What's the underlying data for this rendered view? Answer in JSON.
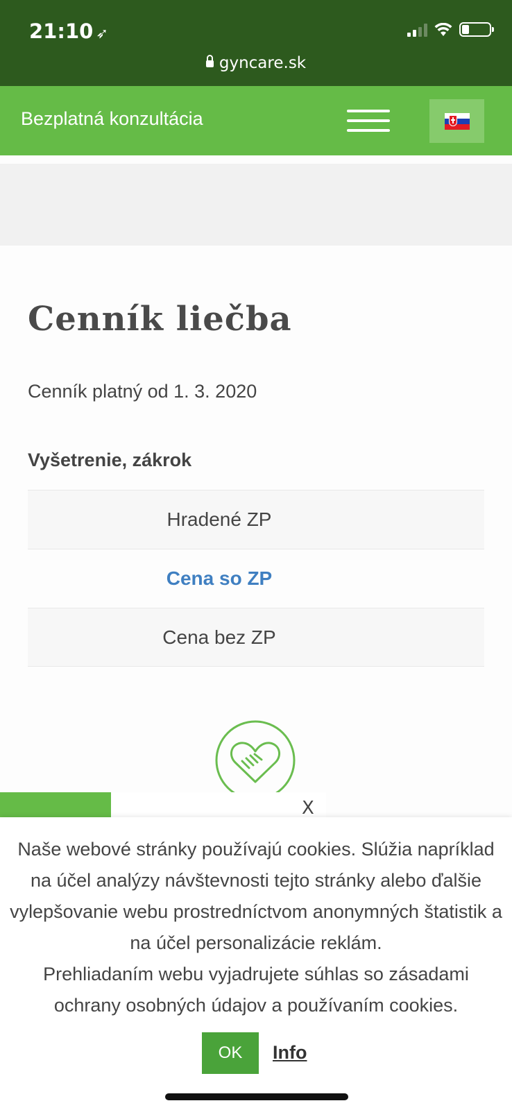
{
  "status_bar": {
    "time": "21:10",
    "location_icon": "location-arrow-icon",
    "url": "gyncare.sk"
  },
  "nav": {
    "consult_label": "Bezplatná konzultácia",
    "menu_icon": "hamburger-icon",
    "language_flag": "slovak-flag-icon"
  },
  "content": {
    "title": "Cenník liečba",
    "validity": "Cenník platný od 1. 3. 2020",
    "exam_label": "Vyšetrenie, zákrok",
    "rows": [
      {
        "label": "Hradené ZP"
      },
      {
        "label": "Cena so ZP"
      },
      {
        "label": "Cena bez ZP"
      }
    ],
    "accent_color": "#3f7fc1"
  },
  "popup": {
    "close_label": "X"
  },
  "cookie": {
    "text": "Naše webové stránky používajú cookies. Slúžia napríklad na účel analýzy návštevnosti tejto stránky alebo ďalšie vylepšovanie webu prostredníctvom anonymných štatistik a na účel personalizácie reklám.",
    "text2": "Prehliadaním webu vyjadrujete súhlas so zásadami ochrany osobných údajov a používaním cookies.",
    "ok_label": "OK",
    "info_label": "Info"
  },
  "colors": {
    "status_bg": "#2d5a1e",
    "nav_bg": "#65bb47",
    "ok_button": "#4aa33a"
  }
}
